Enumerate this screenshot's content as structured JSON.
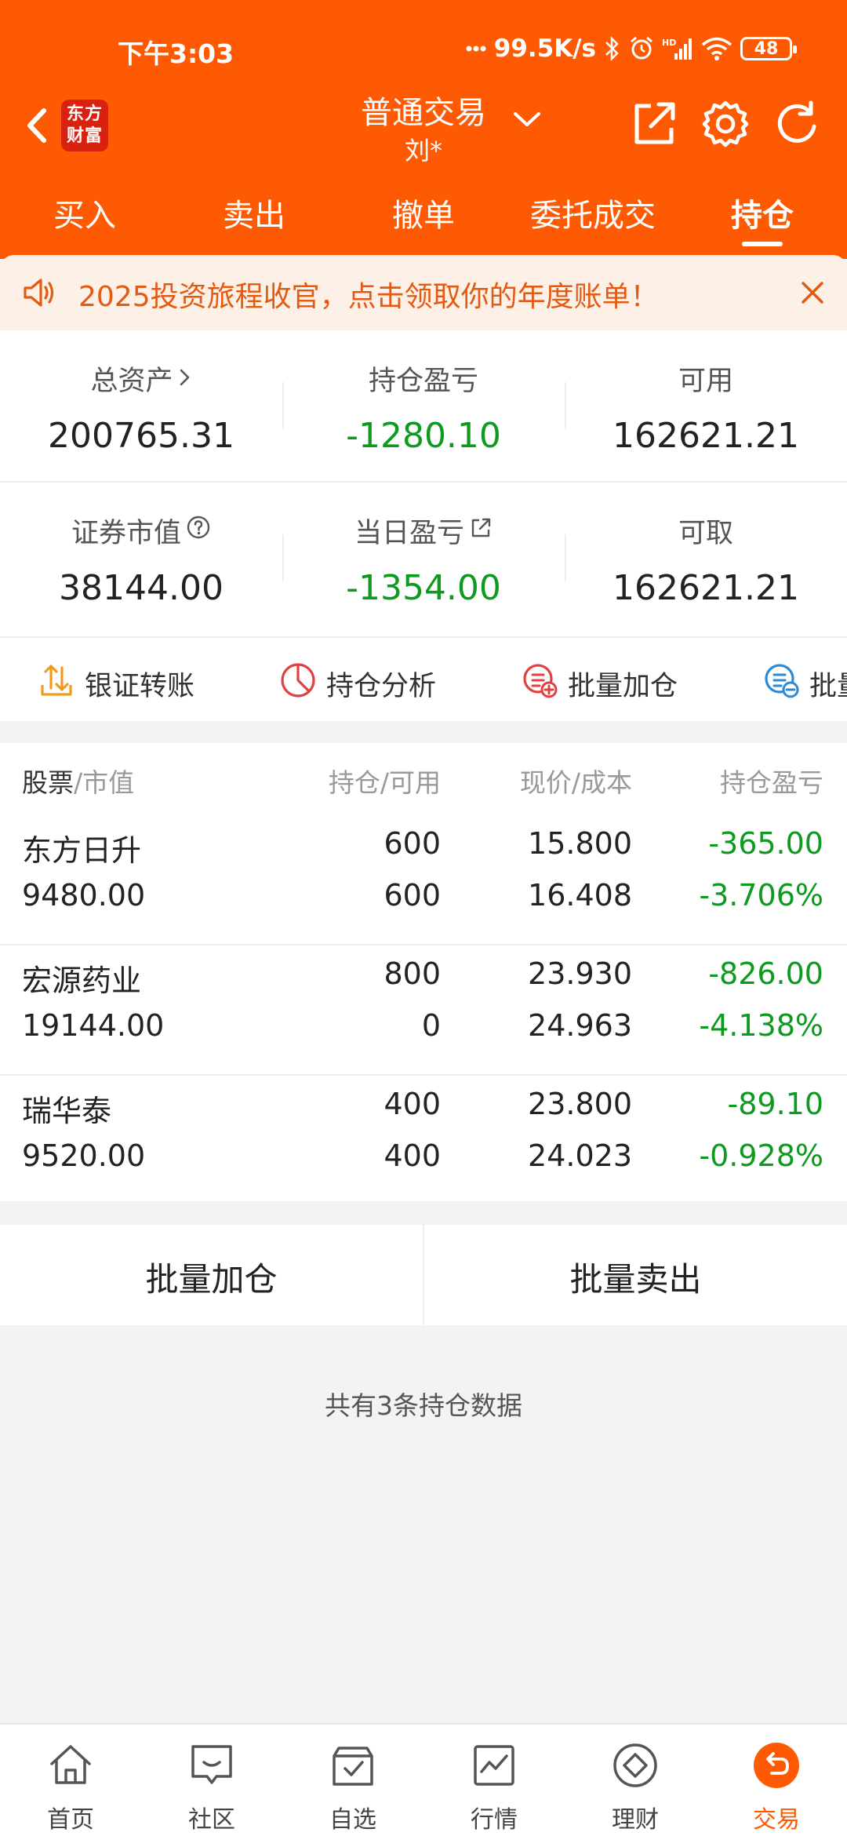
{
  "status_bar": {
    "time": "下午3:03",
    "network_speed": "99.5K/s",
    "battery": "48"
  },
  "header": {
    "logo_line1": "东方",
    "logo_line2": "财富",
    "title": "普通交易",
    "account": "刘*",
    "tabs": [
      {
        "label": "买入",
        "active": false
      },
      {
        "label": "卖出",
        "active": false
      },
      {
        "label": "撤单",
        "active": false
      },
      {
        "label": "委托成交",
        "active": false
      },
      {
        "label": "持仓",
        "active": true
      }
    ]
  },
  "banner": {
    "text": "2025投资旅程收官，点击领取你的年度账单！"
  },
  "assets": {
    "total_assets": {
      "label": "总资产",
      "value": "200765.31"
    },
    "position_pnl": {
      "label": "持仓盈亏",
      "value": "-1280.10"
    },
    "available": {
      "label": "可用",
      "value": "162621.21"
    },
    "market_value": {
      "label": "证券市值",
      "value": "38144.00"
    },
    "daily_pnl": {
      "label": "当日盈亏",
      "value": "-1354.00"
    },
    "withdrawable": {
      "label": "可取",
      "value": "162621.21"
    }
  },
  "quick_actions": [
    {
      "label": "银证转账"
    },
    {
      "label": "持仓分析"
    },
    {
      "label": "批量加仓"
    },
    {
      "label": "批量"
    }
  ],
  "holdings": {
    "headers": {
      "stock": "股票",
      "slash_market": "/市值",
      "position": "持仓/可用",
      "price": "现价/成本",
      "pnl": "持仓盈亏"
    },
    "rows": [
      {
        "name": "东方日升",
        "market_value": "9480.00",
        "position": "600",
        "available": "600",
        "price": "15.800",
        "cost": "16.408",
        "pnl": "-365.00",
        "pnl_pct": "-3.706%"
      },
      {
        "name": "宏源药业",
        "market_value": "19144.00",
        "position": "800",
        "available": "0",
        "price": "23.930",
        "cost": "24.963",
        "pnl": "-826.00",
        "pnl_pct": "-4.138%"
      },
      {
        "name": "瑞华泰",
        "market_value": "9520.00",
        "position": "400",
        "available": "400",
        "price": "23.800",
        "cost": "24.023",
        "pnl": "-89.10",
        "pnl_pct": "-0.928%"
      }
    ]
  },
  "batch": {
    "add_label": "批量加仓",
    "sell_label": "批量卖出"
  },
  "count_text": "共有3条持仓数据",
  "bottom_nav": [
    {
      "label": "首页",
      "icon": "home-icon"
    },
    {
      "label": "社区",
      "icon": "community-icon"
    },
    {
      "label": "自选",
      "icon": "watchlist-icon"
    },
    {
      "label": "行情",
      "icon": "market-icon"
    },
    {
      "label": "理财",
      "icon": "wealth-icon"
    },
    {
      "label": "交易",
      "icon": "trade-icon",
      "active": true
    }
  ],
  "colors": {
    "brand": "#fe5a03",
    "loss_green": "#0d9a1f",
    "banner_text": "#e35a12"
  }
}
